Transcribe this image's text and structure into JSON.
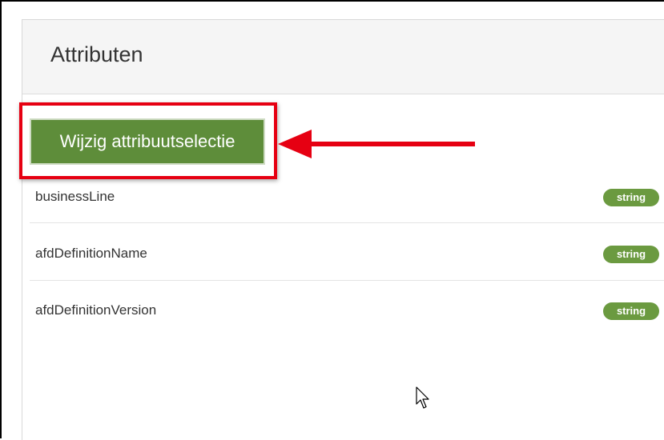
{
  "panel": {
    "title": "Attributen"
  },
  "actions": {
    "change_selection_label": "Wijzig attribuutselectie"
  },
  "attributes": [
    {
      "name": "businessLine",
      "type": "string"
    },
    {
      "name": "afdDefinitionName",
      "type": "string"
    },
    {
      "name": "afdDefinitionVersion",
      "type": "string"
    }
  ],
  "colors": {
    "button_green": "#5e8d3a",
    "badge_green": "#6b9a40",
    "annotation_red": "#e60012"
  },
  "icons": {
    "annotation": "red-arrow-icon",
    "pointer": "mouse-cursor-icon"
  }
}
